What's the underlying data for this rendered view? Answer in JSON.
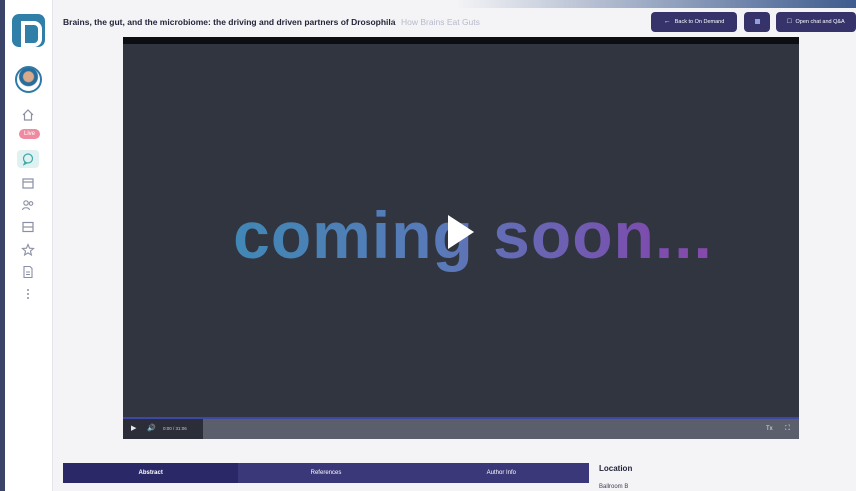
{
  "header": {
    "title": "Brains, the gut, and the microbiome: the driving and driven partners of Drosophila",
    "separator": "/",
    "subtitle": "How Brains Eat Guts",
    "back_button": {
      "icon": "arrow-left-icon",
      "label": "Back to On Demand"
    },
    "square_button": {
      "icon": "grid-icon"
    },
    "chat_button": {
      "icon": "chat-icon",
      "label": "Open chat and Q&A"
    }
  },
  "sidebar": {
    "live_badge": "Live",
    "items": [
      {
        "name": "home",
        "icon": "home-icon"
      },
      {
        "name": "chat",
        "icon": "chat-bubble-icon"
      },
      {
        "name": "calendar",
        "icon": "calendar-icon"
      },
      {
        "name": "people",
        "icon": "people-icon"
      },
      {
        "name": "archive",
        "icon": "archive-icon"
      },
      {
        "name": "favorites",
        "icon": "star-icon"
      },
      {
        "name": "documents",
        "icon": "document-icon"
      },
      {
        "name": "more",
        "icon": "more-vertical-icon"
      }
    ]
  },
  "video": {
    "poster_text": "coming soon...",
    "time_display": "0:00 / 31:06",
    "captions_label": "Tx"
  },
  "tabs": [
    "Abstract",
    "References",
    "Author Info"
  ],
  "location": {
    "label": "Location",
    "value": "Ballroom B"
  },
  "colors": {
    "accent": "#35336a",
    "tab_bar": "#3a3878",
    "live": "#f08aa1",
    "logo": "#2f7fa8"
  }
}
